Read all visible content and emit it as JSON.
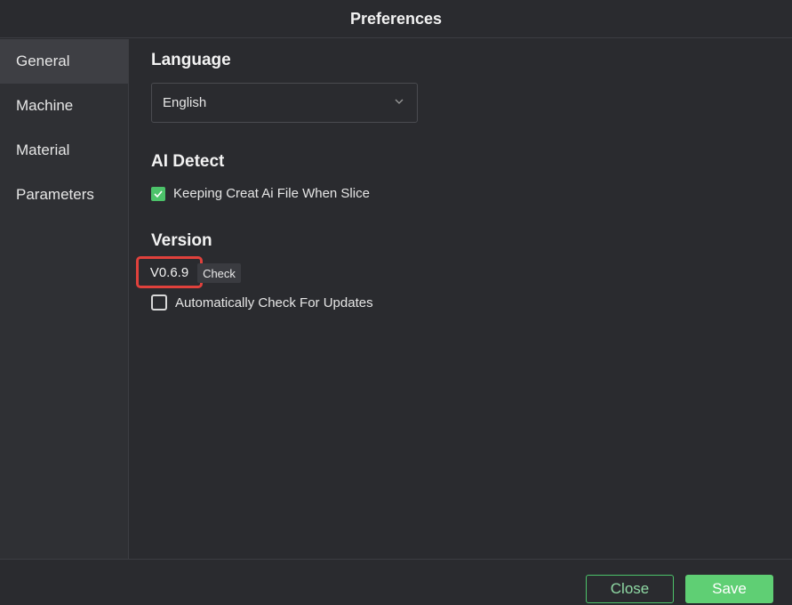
{
  "window": {
    "title": "Preferences"
  },
  "sidebar": {
    "items": [
      {
        "label": "General",
        "active": true
      },
      {
        "label": "Machine",
        "active": false
      },
      {
        "label": "Material",
        "active": false
      },
      {
        "label": "Parameters",
        "active": false
      }
    ]
  },
  "language": {
    "title": "Language",
    "selected": "English",
    "icon": "chevron-down-icon"
  },
  "ai_detect": {
    "title": "AI Detect",
    "keep_file_label": "Keeping Creat Ai File When Slice",
    "keep_file_checked": true
  },
  "version": {
    "title": "Version",
    "value": "V0.6.9",
    "check_label": "Check",
    "auto_check_label": "Automatically Check For Updates",
    "auto_check_checked": false
  },
  "footer": {
    "close_label": "Close",
    "save_label": "Save"
  },
  "colors": {
    "accent": "#4cc36a",
    "highlight": "#e0413c",
    "background": "#2a2b2f"
  }
}
